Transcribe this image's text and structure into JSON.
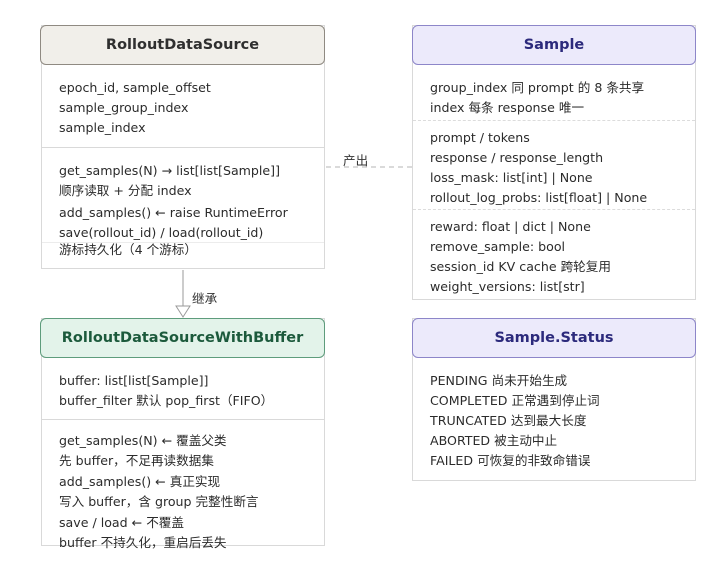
{
  "rollout_data_source": {
    "title": "RolloutDataSource",
    "fields": [
      "epoch_id, sample_offset",
      "sample_group_index",
      "sample_index"
    ],
    "methods": [
      "get_samples(N) → list[list[Sample]]",
      "顺序读取 + 分配 index",
      "add_samples() ← raise RuntimeError",
      "save(rollout_id) / load(rollout_id)",
      "游标持久化（4 个游标）"
    ]
  },
  "sample": {
    "title": "Sample",
    "sections": [
      [
        "group_index 同 prompt 的 8 条共享",
        "index 每条 response 唯一"
      ],
      [
        "prompt / tokens",
        "response / response_length",
        "loss_mask: list[int] | None",
        "rollout_log_probs: list[float] | None"
      ],
      [
        "reward: float | dict | None",
        "remove_sample: bool",
        "session_id KV cache 跨轮复用",
        "weight_versions: list[str]"
      ]
    ]
  },
  "buffer_source": {
    "title": "RolloutDataSourceWithBuffer",
    "fields": [
      "buffer: list[list[Sample]]",
      "buffer_filter 默认 pop_first（FIFO）"
    ],
    "methods": [
      "get_samples(N) ← 覆盖父类",
      "先 buffer，不足再读数据集",
      "add_samples() ← 真正实现",
      "写入 buffer，含 group 完整性断言",
      "save / load ← 不覆盖",
      "buffer 不持久化，重启后丢失"
    ]
  },
  "sample_status": {
    "title": "Sample.Status",
    "items": [
      "PENDING 尚未开始生成",
      "COMPLETED 正常遇到停止词",
      "TRUNCATED 达到最大长度",
      "ABORTED 被主动中止",
      "FAILED 可恢复的非致命错误"
    ]
  },
  "edges": {
    "produces": "产出",
    "inherits": "继承"
  }
}
